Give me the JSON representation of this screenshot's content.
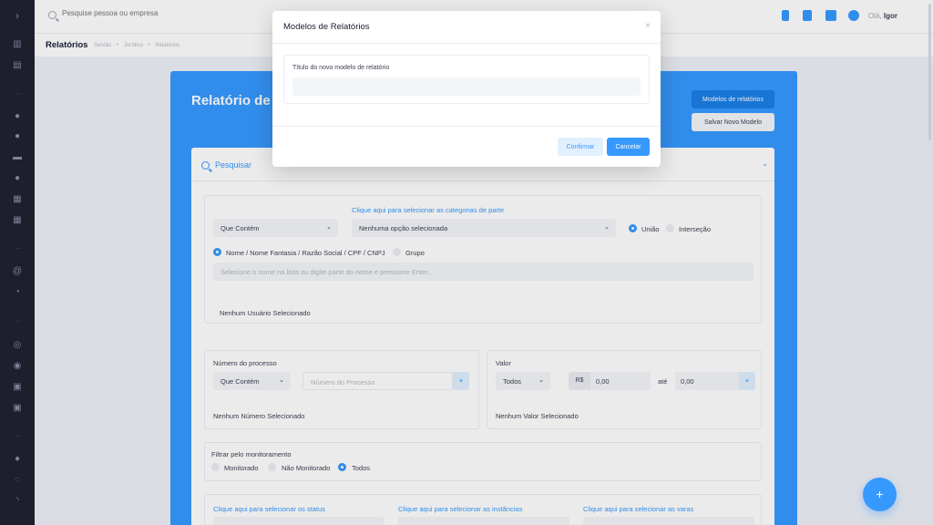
{
  "header": {
    "search_placeholder": "Pesquise pessoa ou empresa",
    "greeting": "Olá,",
    "user_name": "Igor"
  },
  "subheader": {
    "title": "Relatórios",
    "breadcrumb": [
      "Gestão",
      "Jurídico",
      "Relatórios"
    ]
  },
  "page": {
    "report_title": "Relatório de",
    "btn_models": "Modelos de relatórios",
    "btn_save_model": "Salvar Novo Modelo"
  },
  "search": {
    "title": "Pesquisar",
    "categories_link": "Clique aqui para selecionar as categorias de parte",
    "match_select": "Que Contém",
    "categories_select": "Nenhuma opção selecionada",
    "union_label": "União",
    "intersection_label": "Interseção",
    "name_option": "Nome / Nome Fantasia / Razão Social / CPF / CNPJ",
    "group_option": "Grupo",
    "name_placeholder": "Selecione o nome na lista ou digite parte do nome e pressione Enter...",
    "no_user": "Nenhum Usuário Selecionado",
    "process": {
      "label": "Número do processo",
      "match_select": "Que Contém",
      "placeholder": "Número do Processo",
      "add": "+",
      "none": "Nenhum Número Selecionado"
    },
    "value": {
      "label": "Valor",
      "select": "Todos",
      "currency": "R$",
      "from": "0,00",
      "to_label": "até",
      "to": "0,00",
      "add": "+",
      "none": "Nenhum Valor Selecionado"
    },
    "monitor": {
      "label": "Filtrar pelo monitoramento",
      "options": [
        "Monitorado",
        "Não Monitorado",
        "Todos"
      ]
    },
    "status_link": "Clique aqui para selecionar os status",
    "instances_link": "Clique aqui para selecionar as instâncias",
    "courts_link": "Clique aqui para selecionar as varas"
  },
  "modal": {
    "title": "Modelos de Relatórios",
    "close": "×",
    "field_label": "Título do novo modelo de relatório",
    "field_value": "",
    "confirm": "Confirmar",
    "cancel": "Cancelar"
  },
  "fab": "+",
  "colors": {
    "primary": "#3699ff",
    "sidebar": "#1e1e2d",
    "light_bg": "#f3f6f9"
  }
}
